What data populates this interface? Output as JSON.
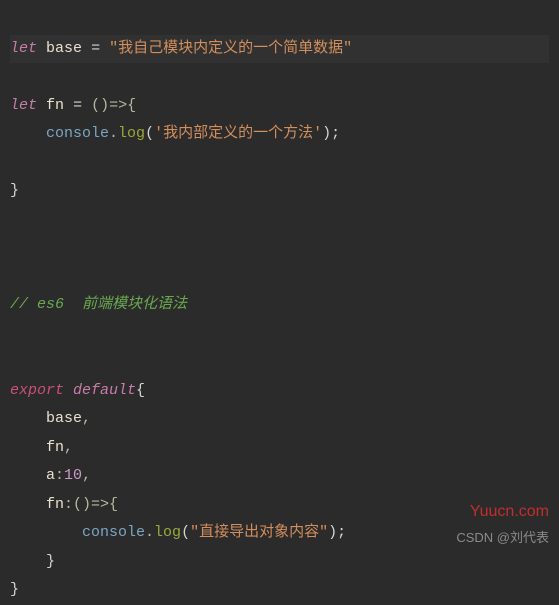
{
  "line1": {
    "let": "let",
    "ident": "base",
    "eq": "=",
    "str": "\"我自己模块内定义的一个简单数据\""
  },
  "line3": {
    "let": "let",
    "ident": "fn",
    "eq": "=",
    "arrow": "()=>{"
  },
  "line4": {
    "console": "console",
    "dot": ".",
    "log": "log",
    "open": "(",
    "str": "'我内部定义的一个方法'",
    "close": ");"
  },
  "line6": {
    "brace": "}"
  },
  "line10": {
    "comment": "// es6  前端模块化语法"
  },
  "line13": {
    "export": "export",
    "default": "default",
    "brace": "{"
  },
  "line14": {
    "key": "base",
    "comma": ","
  },
  "line15": {
    "key": "fn",
    "comma": ","
  },
  "line16": {
    "key": "a",
    "colon": ":",
    "val": "10",
    "comma": ","
  },
  "line17": {
    "key": "fn",
    "colon": ":",
    "arrow": "()=>{"
  },
  "line18": {
    "console": "console",
    "dot": ".",
    "log": "log",
    "open": "(",
    "str": "\"直接导出对象内容\"",
    "close": ");"
  },
  "line19": {
    "brace": "}"
  },
  "line20": {
    "brace": "}"
  },
  "watermark1": "Yuucn.com",
  "watermark2": "CSDN @刘代表"
}
